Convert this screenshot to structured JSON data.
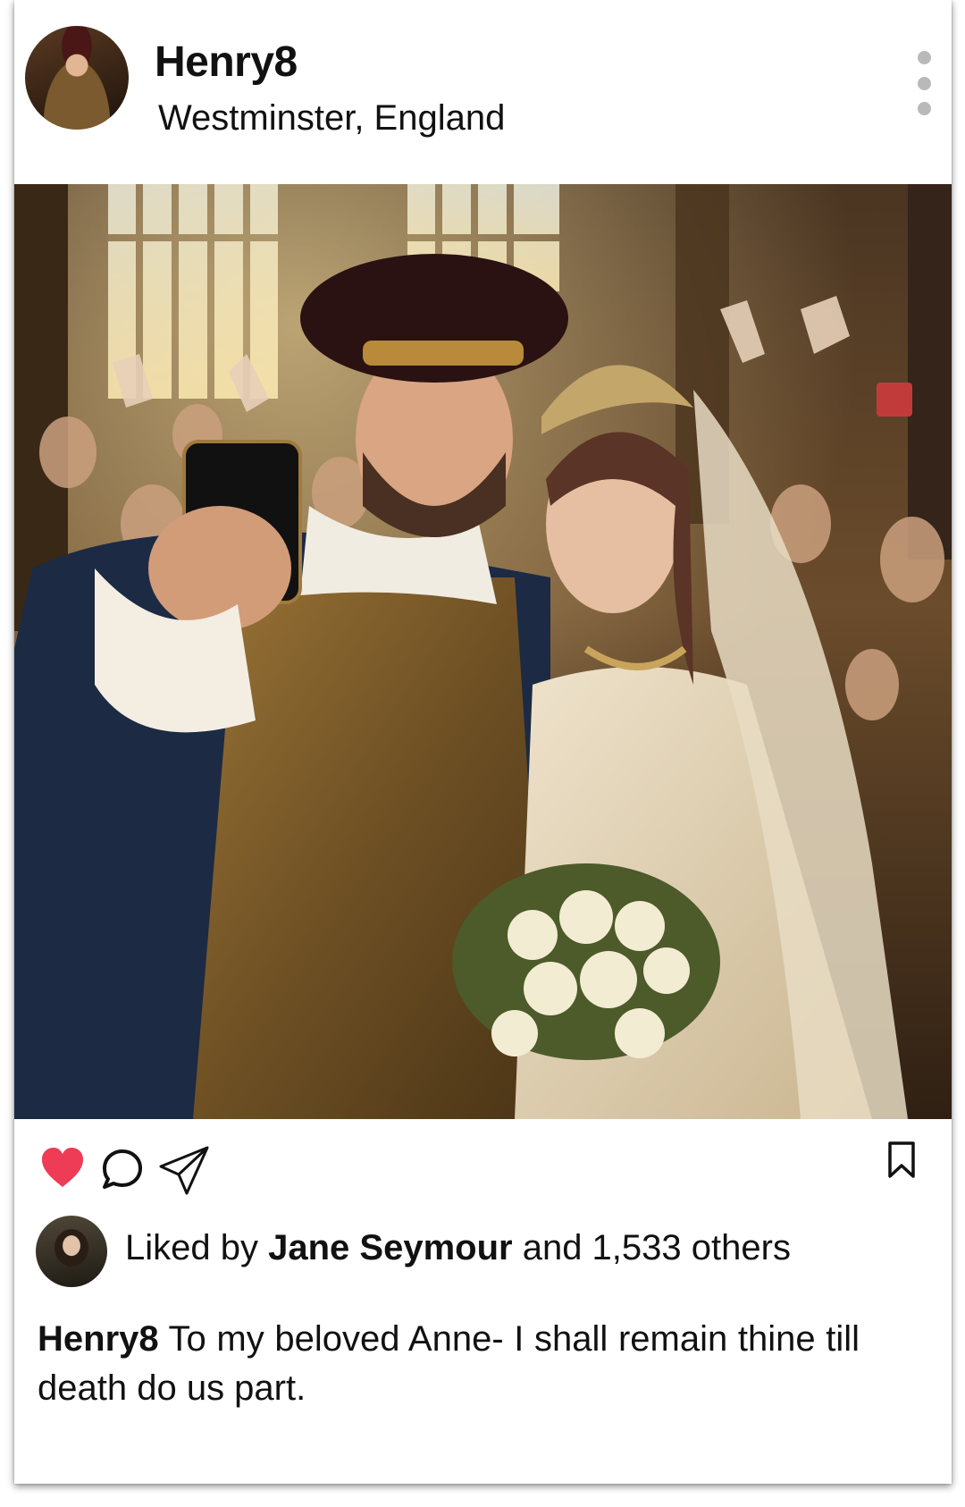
{
  "post": {
    "username": "Henry8",
    "location": "Westminster, England",
    "more_icon": "more-vertical-icon",
    "photo_alt": "",
    "actions": {
      "like_icon": "heart-icon",
      "liked": true,
      "like_color": "#ee3b56",
      "comment_icon": "comment-icon",
      "share_icon": "send-icon",
      "save_icon": "bookmark-icon"
    },
    "likes": {
      "prefix": "Liked by",
      "name": "Jane Seymour",
      "suffix": "and 1,533 others"
    },
    "caption": {
      "author": "Henry8",
      "text": "To my beloved Anne- I shall remain thine till death do us part."
    }
  }
}
